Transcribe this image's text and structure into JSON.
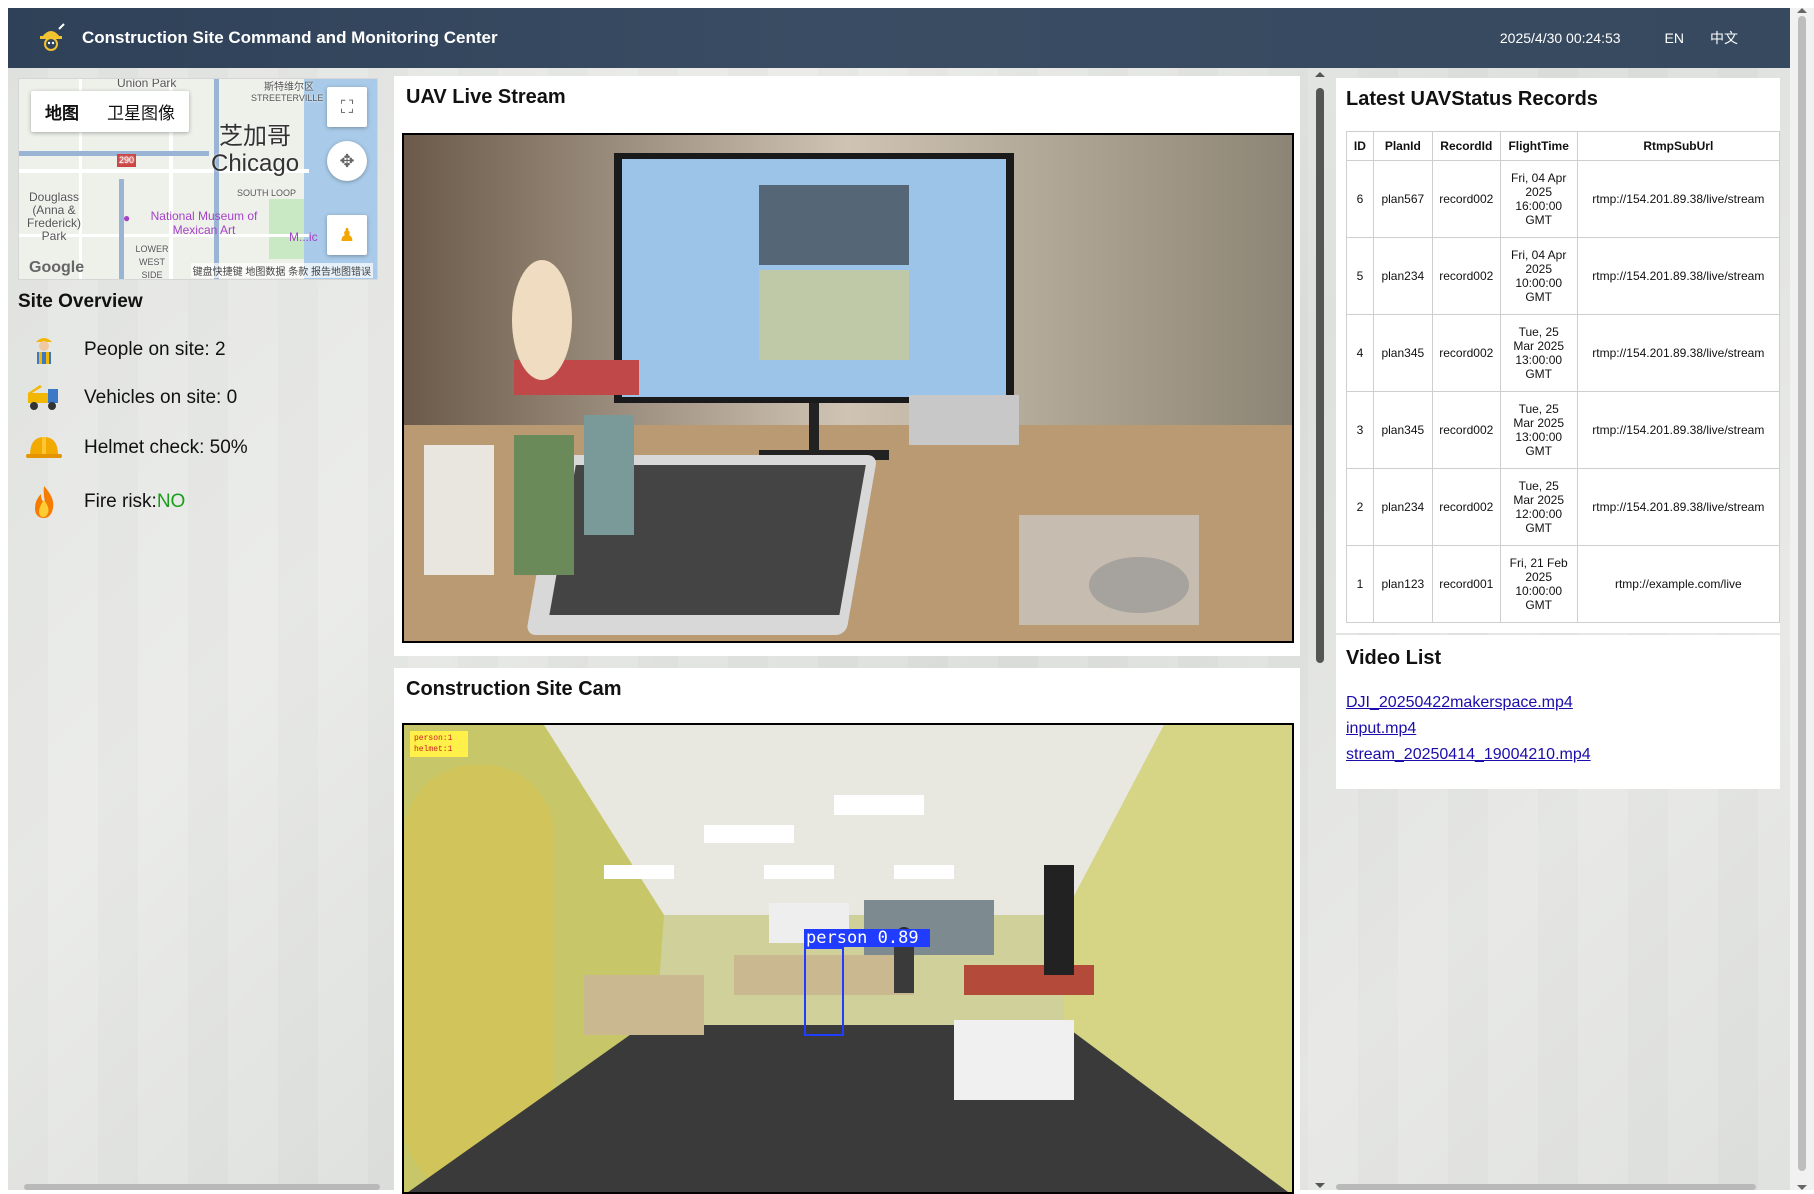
{
  "header": {
    "title": "Construction Site Command and Monitoring Center",
    "datetime": "2025/4/30 00:24:53",
    "lang_en": "EN",
    "lang_zh": "中文"
  },
  "map": {
    "tab_map": "地图",
    "tab_satellite": "卫星图像",
    "city_zh": "芝加哥",
    "city_en": "Chicago",
    "labels": {
      "union_park": "Union Park",
      "streeterville_zh": "斯特维尔区",
      "streeterville": "STREETERVILLE",
      "south_loop": "SOUTH LOOP",
      "douglass": "Douglass (Anna & Frederick) Park",
      "lower_west_side": "LOWER WEST SIDE",
      "museum": "National Museum of Mexican Art",
      "museum2": "M...ic",
      "i290": "290"
    },
    "google": "Google",
    "footer": "键盘快捷键   地图数据   条款   报告地图错误"
  },
  "overview": {
    "title": "Site Overview",
    "people": "People on site: 2",
    "vehicles": "Vehicles on site: 0",
    "helmet": "Helmet check: 50%",
    "fire_label": "Fire risk:",
    "fire_value": "NO"
  },
  "uav": {
    "title": "UAV Live Stream"
  },
  "cam": {
    "title": "Construction Site Cam",
    "overlay_person": "person:1",
    "overlay_helmet": "helmet:1",
    "detection_label": "person 0.89"
  },
  "records": {
    "title": "Latest UAVStatus Records",
    "columns": [
      "ID",
      "PlanId",
      "RecordId",
      "FlightTime",
      "RtmpSubUrl"
    ],
    "rows": [
      {
        "id": "6",
        "plan": "plan567",
        "record": "record002",
        "time": "Fri, 04 Apr 2025 16:00:00 GMT",
        "url": "rtmp://154.201.89.38/live/stream"
      },
      {
        "id": "5",
        "plan": "plan234",
        "record": "record002",
        "time": "Fri, 04 Apr 2025 10:00:00 GMT",
        "url": "rtmp://154.201.89.38/live/stream"
      },
      {
        "id": "4",
        "plan": "plan345",
        "record": "record002",
        "time": "Tue, 25 Mar 2025 13:00:00 GMT",
        "url": "rtmp://154.201.89.38/live/stream"
      },
      {
        "id": "3",
        "plan": "plan345",
        "record": "record002",
        "time": "Tue, 25 Mar 2025 13:00:00 GMT",
        "url": "rtmp://154.201.89.38/live/stream"
      },
      {
        "id": "2",
        "plan": "plan234",
        "record": "record002",
        "time": "Tue, 25 Mar 2025 12:00:00 GMT",
        "url": "rtmp://154.201.89.38/live/stream"
      },
      {
        "id": "1",
        "plan": "plan123",
        "record": "record001",
        "time": "Fri, 21 Feb 2025 10:00:00 GMT",
        "url": "rtmp://example.com/live"
      }
    ]
  },
  "videos": {
    "title": "Video List",
    "items": [
      "DJI_20250422makerspace.mp4",
      "input.mp4",
      "stream_20250414_19004210.mp4"
    ]
  },
  "colors": {
    "header_bg": "#34465c",
    "fire_ok": "#1a9d1a",
    "link": "#1a0dab",
    "detection_box": "#1f3cff",
    "overlay_yellow": "#fff04a"
  }
}
